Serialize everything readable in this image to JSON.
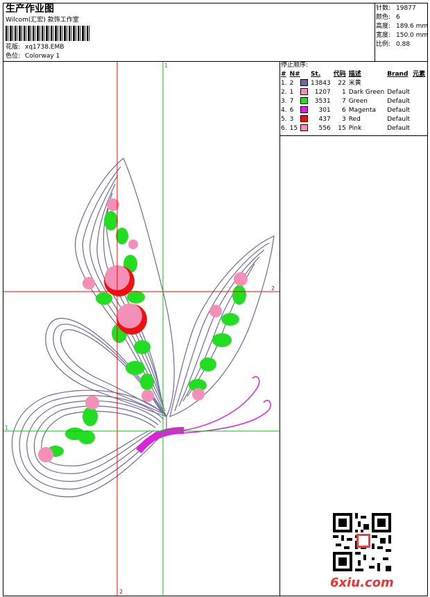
{
  "header": {
    "title": "生产作业图",
    "company": "Wilcom(汇宏) 款饰工作室",
    "design_label": "花版:",
    "design_value": "xq1738.EMB",
    "color_label": "色位:",
    "color_value": "Colorway 1"
  },
  "specs": [
    {
      "label": "针数:",
      "value": "19877"
    },
    {
      "label": "颜色:",
      "value": "6"
    },
    {
      "label": "高度:",
      "value": "189.6 mm"
    },
    {
      "label": "宽度:",
      "value": "150.0 mm"
    },
    {
      "label": "比例:",
      "value": "0.88"
    }
  ],
  "stop_sequence": {
    "title": "停止顺序:",
    "columns": [
      "#",
      "N#",
      "St.",
      "代码",
      "描述",
      "Brand",
      "元素"
    ],
    "rows": [
      {
        "idx": "1.",
        "n": "2",
        "color": "#6d6a9a",
        "st": "13843",
        "code": "22",
        "desc": "米黄",
        "brand": ""
      },
      {
        "idx": "2.",
        "n": "1",
        "color": "#f48fb8",
        "st": "1207",
        "code": "1",
        "desc": "Dark Green",
        "brand": "Default"
      },
      {
        "idx": "3.",
        "n": "7",
        "color": "#22dd22",
        "st": "3531",
        "code": "7",
        "desc": "Green",
        "brand": "Default"
      },
      {
        "idx": "4.",
        "n": "6",
        "color": "#dd22dd",
        "st": "301",
        "code": "6",
        "desc": "Magenta",
        "brand": "Default"
      },
      {
        "idx": "5.",
        "n": "3",
        "color": "#ee1111",
        "st": "437",
        "code": "3",
        "desc": "Red",
        "brand": "Default"
      },
      {
        "idx": "6.",
        "n": "15",
        "color": "#f48fb8",
        "st": "556",
        "code": "15",
        "desc": "Pink",
        "brand": "Default"
      }
    ]
  },
  "guides": {
    "v_green_label": "1",
    "h_red_label": "2",
    "h_green_label": "1",
    "v_red_label": "2"
  },
  "watermark": "6xiu.com",
  "colors": {
    "thread_body": "#6d6a9a",
    "leaf_green": "#22dd22",
    "pink": "#f48fb8",
    "red": "#ee1111",
    "magenta": "#dd22dd",
    "guide_red": "#ff0000",
    "guide_green": "#00cc00"
  }
}
